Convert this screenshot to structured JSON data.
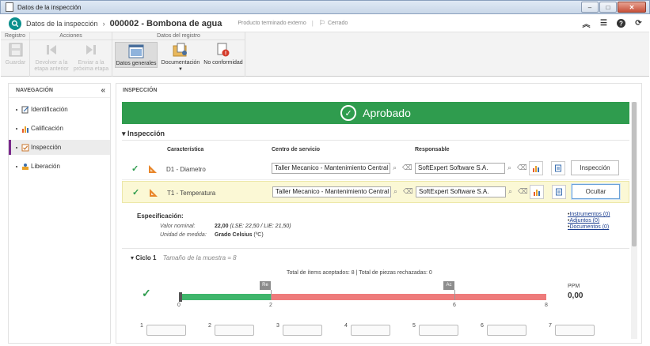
{
  "window": {
    "title": "Datos de la inspección",
    "controls": [
      "–",
      "□",
      "✕"
    ]
  },
  "header": {
    "breadcrumb_root": "Datos de la inspección",
    "separator": "›",
    "record": "000002 - Bombona de agua",
    "meta_type": "Producto terminado externo",
    "meta_status": "Cerrado",
    "right_icons": [
      "collapse-up-icon",
      "list-icon",
      "help-icon",
      "refresh-icon"
    ]
  },
  "ribbon": {
    "groups": [
      {
        "title": "Registro"
      },
      {
        "title": "Acciones"
      },
      {
        "title": "Datos del registro"
      }
    ],
    "buttons": {
      "guardar": "Guardar",
      "devolver": "Devolver a la etapa anterior",
      "enviar": "Enviar a la próxima etapa",
      "datos_generales": "Datos generales",
      "documentacion": "Documentación",
      "no_conformidad": "No conformidad"
    }
  },
  "nav": {
    "title": "NAVEGACIÓN",
    "collapse": "«",
    "items": [
      {
        "label": "Identificación",
        "icon": "identification-icon"
      },
      {
        "label": "Calificación",
        "icon": "bar-chart-icon"
      },
      {
        "label": "Inspección",
        "icon": "checklist-icon",
        "active": true
      },
      {
        "label": "Liberación",
        "icon": "release-icon"
      }
    ]
  },
  "main": {
    "title": "INSPECCIÓN",
    "banner": "Aprobado",
    "section": "Inspección",
    "columns": {
      "caracteristica": "Característica",
      "centro": "Centro de servicio",
      "responsable": "Responsable"
    },
    "rows": [
      {
        "name": "D1 - Diametro",
        "centro": "Taller Mecanico - Mantenimiento Central d",
        "responsable": "SoftExpert Software S.A.",
        "button": "Inspección"
      },
      {
        "name": "T1 - Temperatura",
        "centro": "Taller Mecanico - Mantenimiento Central d",
        "responsable": "SoftExpert Software S.A.",
        "button": "Ocultar"
      }
    ],
    "spec": {
      "title": "Especificación:",
      "nominal_label": "Valor nominal:",
      "nominal_value": "22,00",
      "nominal_limits": "(LSE: 22,50 / LIE: 21,50)",
      "unit_label": "Unidad de medida:",
      "unit_value": "Grado Celsius",
      "unit_symbol": "(ºC)"
    },
    "links": [
      "Instrumentos (0)",
      "Adjuntos (0)",
      "Documentos (0)"
    ],
    "cycle": {
      "title": "Ciclo 1",
      "sample_size": "Tamaño de la muestra = 8",
      "totals": "Total de ítems aceptados: 8 | Total de piezas rechazadas: 0",
      "gauge": {
        "min": 0,
        "re": 2,
        "ac": 6,
        "max": 8,
        "re_label": "Re",
        "ac_label": "Ac",
        "ticks": [
          "0",
          "2",
          "6",
          "8"
        ]
      },
      "ppm_label": "PPM",
      "ppm_value": "0,00",
      "samples": [
        "1",
        "2",
        "3",
        "4",
        "5",
        "6",
        "7"
      ]
    }
  }
}
